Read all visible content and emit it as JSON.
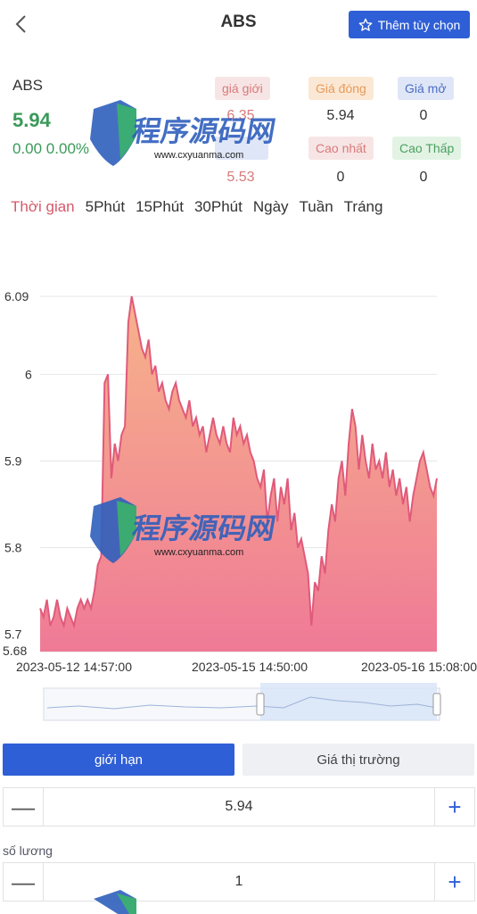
{
  "header": {
    "title": "ABS",
    "add_label": "Thêm tùy chọn"
  },
  "quote": {
    "symbol": "ABS",
    "price": "5.94",
    "change": "0.00 0.00%"
  },
  "stats": [
    {
      "label": "giá giới",
      "value": "6.35",
      "color": "#f7e5e5",
      "text": "#d97a7a",
      "vcolor": "#d97a7a"
    },
    {
      "label": "Giá đóng",
      "value": "5.94",
      "color": "#fbe8d4",
      "text": "#e89a5a",
      "vcolor": "#333333"
    },
    {
      "label": "Giá mở",
      "value": "0",
      "color": "#dfe6f7",
      "text": "#4a6fc4",
      "vcolor": "#333333"
    },
    {
      "label": "",
      "value": "5.53",
      "color": "#dfe6f7",
      "text": "#4a6fc4",
      "vcolor": "#d97a7a"
    },
    {
      "label": "Cao nhất",
      "value": "0",
      "color": "#f7e5e5",
      "text": "#d97a7a",
      "vcolor": "#333333"
    },
    {
      "label": "Cao Thấp",
      "value": "0",
      "color": "#e2f3e4",
      "text": "#4aa060",
      "vcolor": "#333333"
    }
  ],
  "tabs": [
    "Thời gian",
    "5Phút",
    "15Phút",
    "30Phút",
    "Ngày",
    "Tuần",
    "Tráng"
  ],
  "chart_data": {
    "type": "area",
    "y_ticks": [
      "6.09",
      "6",
      "5.9",
      "5.8",
      "5.7",
      "5.68"
    ],
    "ylim": [
      5.68,
      6.09
    ],
    "x_ticks": [
      "2023-05-12 14:57:00",
      "2023-05-15 14:50:00",
      "2023-05-16 15:08:00"
    ],
    "values": [
      5.73,
      5.72,
      5.74,
      5.71,
      5.72,
      5.74,
      5.72,
      5.71,
      5.73,
      5.72,
      5.71,
      5.73,
      5.74,
      5.73,
      5.74,
      5.73,
      5.75,
      5.78,
      5.79,
      5.99,
      6.0,
      5.88,
      5.92,
      5.9,
      5.93,
      5.94,
      6.06,
      6.09,
      6.07,
      6.05,
      6.03,
      6.02,
      6.04,
      6.0,
      6.01,
      5.98,
      5.99,
      5.97,
      5.96,
      5.98,
      5.99,
      5.97,
      5.96,
      5.95,
      5.97,
      5.94,
      5.95,
      5.93,
      5.94,
      5.91,
      5.93,
      5.95,
      5.93,
      5.92,
      5.94,
      5.92,
      5.91,
      5.95,
      5.93,
      5.94,
      5.92,
      5.93,
      5.91,
      5.9,
      5.88,
      5.87,
      5.89,
      5.83,
      5.86,
      5.88,
      5.83,
      5.87,
      5.85,
      5.88,
      5.82,
      5.84,
      5.8,
      5.81,
      5.79,
      5.77,
      5.71,
      5.76,
      5.75,
      5.79,
      5.77,
      5.82,
      5.85,
      5.83,
      5.88,
      5.9,
      5.86,
      5.92,
      5.96,
      5.94,
      5.89,
      5.93,
      5.9,
      5.88,
      5.92,
      5.89,
      5.9,
      5.88,
      5.91,
      5.87,
      5.89,
      5.86,
      5.88,
      5.85,
      5.87,
      5.83,
      5.86,
      5.88,
      5.9,
      5.91,
      5.89,
      5.87,
      5.86,
      5.88
    ],
    "line_color": "#e05a7a",
    "fill_top": "#f7b38a",
    "fill_bottom": "#ef7a96"
  },
  "order": {
    "limit_label": "giới hạn",
    "market_label": "Giá thị trường",
    "price_value": "5.94",
    "qty_label": "số lương",
    "qty_value": "1",
    "minus": "—",
    "plus": "+"
  }
}
